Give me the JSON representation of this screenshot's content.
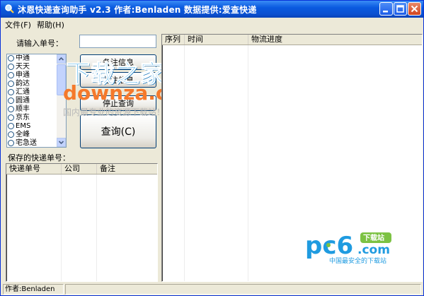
{
  "window": {
    "title": "沐恩快递查询助手 v2.3  作者:Benladen 数据提供:爱查快递"
  },
  "menu": {
    "items": [
      "文件(F)",
      "帮助(H)"
    ]
  },
  "query": {
    "label": "请输入单号：",
    "value": ""
  },
  "carriers": [
    "中通",
    "天天",
    "申通",
    "韵达",
    "汇通",
    "圆通",
    "顺丰",
    "京东",
    "EMS",
    "全峰",
    "宅急送"
  ],
  "buttons": {
    "save_remark": "备注信息",
    "remark_info": "备注信息",
    "stop_query": "停止查询",
    "query": "查询(C)"
  },
  "saved": {
    "label": "保存的快递单号：",
    "columns": [
      "快递单号",
      "公司",
      "备注"
    ]
  },
  "results": {
    "columns": [
      "序列",
      "时间",
      "物流进度"
    ]
  },
  "watermark": {
    "title": "下载之家",
    "url": "downza.cn",
    "slogan": "国内最专业的资源下载站！"
  },
  "pc6": {
    "brand": "pc6",
    "domain": ".com",
    "badge": "下载站",
    "slogan": "中国最安全的下载站"
  },
  "status": {
    "author": "作者:Benladen",
    "extra": ""
  },
  "colors": {
    "titlebar": "#0a5ae0",
    "window_bg": "#ece9d8",
    "watermark_blue": "#2fa3e6",
    "watermark_orange": "#f5792b",
    "pc6_blue": "#1f9be0",
    "pc6_green": "#7cc243"
  }
}
